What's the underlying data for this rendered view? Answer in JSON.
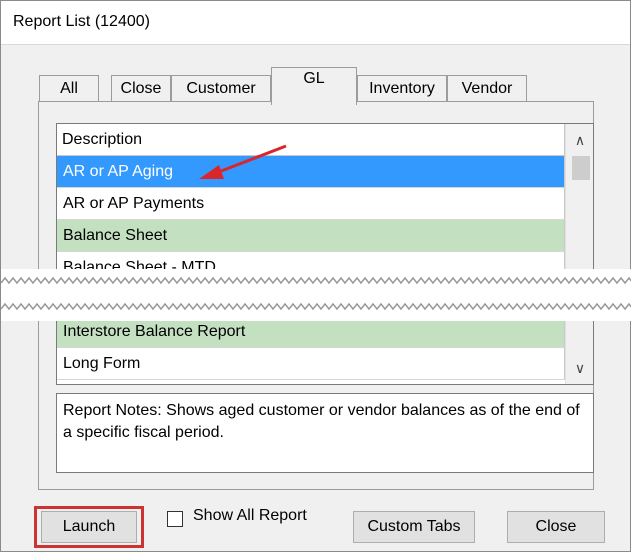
{
  "window": {
    "title": "Report List (12400)"
  },
  "tabs": [
    {
      "label": "All",
      "active": false
    },
    {
      "label": "Close",
      "active": false
    },
    {
      "label": "Customer",
      "active": false
    },
    {
      "label": "GL",
      "active": true
    },
    {
      "label": "Inventory",
      "active": false
    },
    {
      "label": "Vendor",
      "active": false
    }
  ],
  "list": {
    "header": "Description",
    "rows": [
      {
        "label": "AR or AP Aging",
        "state": "selected"
      },
      {
        "label": "AR or AP Payments",
        "state": "white"
      },
      {
        "label": "Balance Sheet",
        "state": "green"
      },
      {
        "label": "Balance Sheet - MTD",
        "state": "white"
      },
      {
        "label": "Interstore Balance Report",
        "state": "green"
      },
      {
        "label": "Long Form",
        "state": "white"
      }
    ]
  },
  "notes": {
    "text": "Report Notes:  Shows aged customer or vendor balances as of the end of a specific fiscal period."
  },
  "buttons": {
    "launch": "Launch",
    "show_all_report": "Show All Report",
    "custom_tabs": "Custom Tabs",
    "close": "Close"
  },
  "colors": {
    "selected_row": "#3399ff",
    "green_row": "#c3e0c1",
    "highlight": "#cc3333",
    "arrow": "#d9262b"
  },
  "icons": {
    "scroll_up": "chevron-up-icon",
    "scroll_down": "chevron-down-icon",
    "pointer_arrow": "red-arrow-annotation"
  }
}
